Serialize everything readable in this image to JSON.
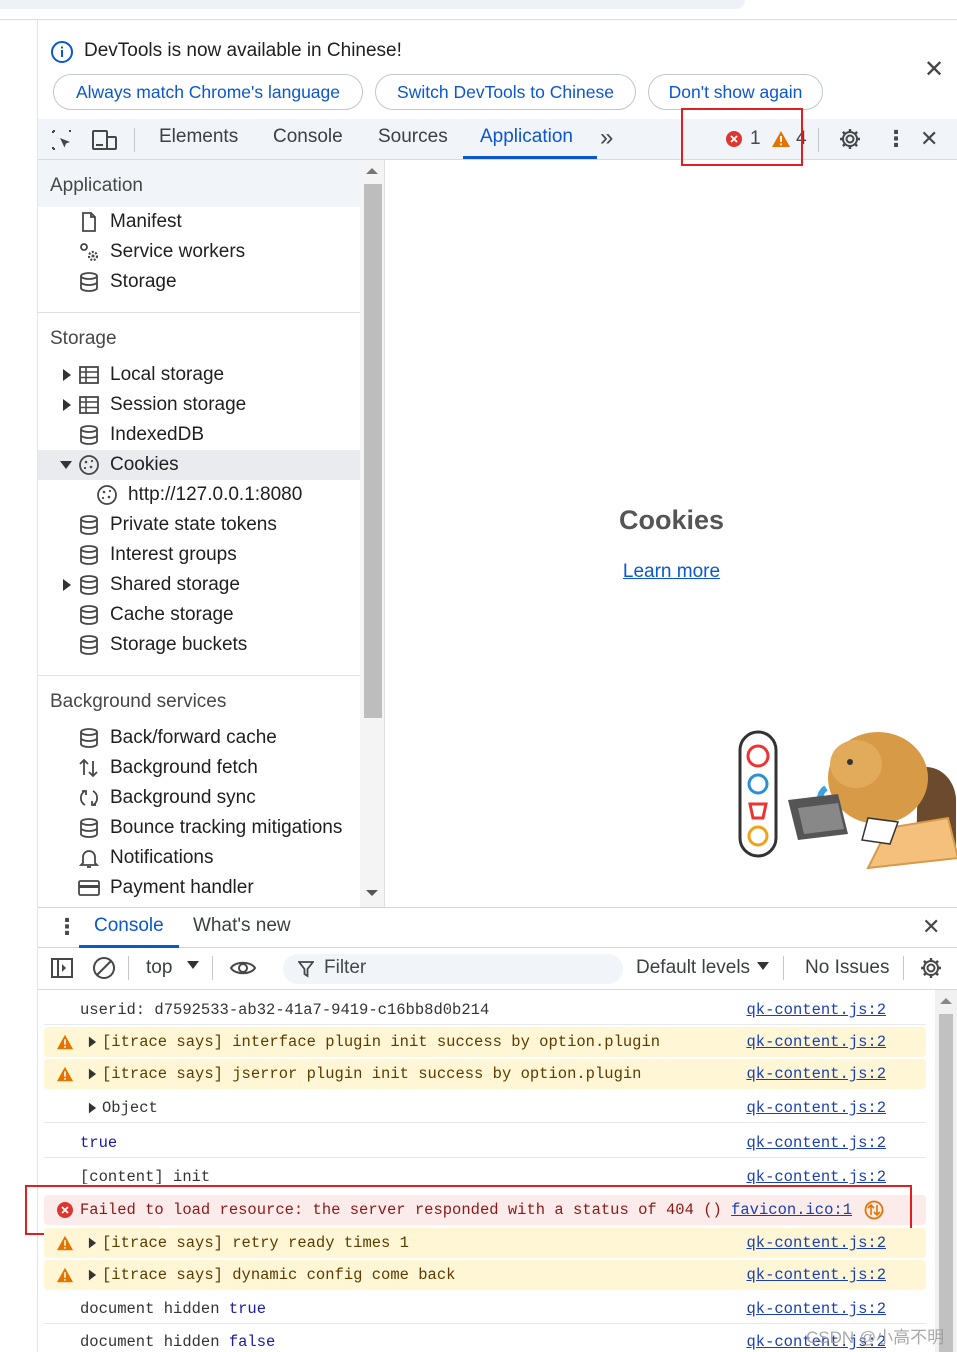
{
  "infobar": {
    "message": "DevTools is now available in Chinese!",
    "buttons": [
      "Always match Chrome's language",
      "Switch DevTools to Chinese",
      "Don't show again"
    ]
  },
  "toolbar": {
    "tabs": [
      "Elements",
      "Console",
      "Sources",
      "Application"
    ],
    "active_tab": "Application",
    "error_count": "1",
    "warning_count": "4"
  },
  "sidebar": {
    "application": {
      "title": "Application",
      "items": [
        "Manifest",
        "Service workers",
        "Storage"
      ]
    },
    "storage": {
      "title": "Storage",
      "items": [
        "Local storage",
        "Session storage",
        "IndexedDB",
        "Cookies",
        "http://127.0.0.1:8080",
        "Private state tokens",
        "Interest groups",
        "Shared storage",
        "Cache storage",
        "Storage buckets"
      ]
    },
    "background": {
      "title": "Background services",
      "items": [
        "Back/forward cache",
        "Background fetch",
        "Background sync",
        "Bounce tracking mitigations",
        "Notifications",
        "Payment handler"
      ]
    }
  },
  "main": {
    "title": "Cookies",
    "link": "Learn more"
  },
  "drawer": {
    "tabs": [
      "Console",
      "What's new"
    ],
    "context": "top",
    "filter_placeholder": "Filter",
    "levels": "Default levels",
    "issues": "No Issues"
  },
  "console": {
    "rows": [
      {
        "type": "plain",
        "text": "userid: d7592533-ab32-41a7-9419-c16bb8d0b214",
        "src": "qk-content.js:2"
      },
      {
        "type": "warn",
        "text": "[itrace says] interface plugin init success by option.plugin",
        "src": "qk-content.js:2"
      },
      {
        "type": "warn",
        "text": "[itrace says] jserror plugin init success by option.plugin",
        "src": "qk-content.js:2"
      },
      {
        "type": "plain",
        "text": "Object",
        "src": "qk-content.js:2"
      },
      {
        "type": "plain",
        "text": "true",
        "src": "qk-content.js:2"
      },
      {
        "type": "plain",
        "text": "[content] init",
        "src": "qk-content.js:2"
      },
      {
        "type": "err",
        "text": "Failed to load resource: the server responded with a status of 404 ()",
        "src": "favicon.ico:1"
      },
      {
        "type": "warn",
        "text": "[itrace says] retry ready times 1",
        "src": "qk-content.js:2"
      },
      {
        "type": "warn",
        "text": "[itrace says] dynamic config come back",
        "src": "qk-content.js:2"
      },
      {
        "type": "plain",
        "text": "document hidden ",
        "value": "true",
        "src": "qk-content.js:2"
      },
      {
        "type": "plain",
        "text": "document hidden ",
        "value": "false",
        "src": "qk-content.js:2"
      }
    ]
  },
  "watermark": "CSDN @小高不明"
}
